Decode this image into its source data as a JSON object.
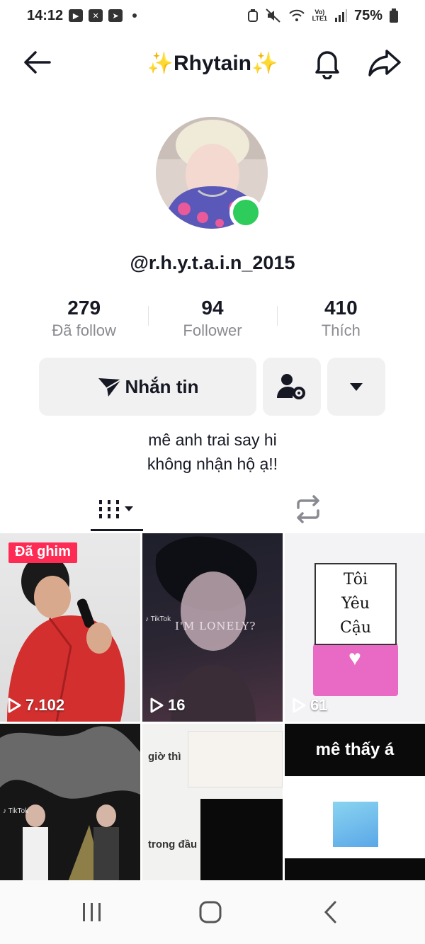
{
  "status": {
    "time": "14:12",
    "network_top": "Vo)",
    "network_bottom": "LTE1",
    "battery": "75%"
  },
  "header": {
    "title": "✨Rhytain✨"
  },
  "profile": {
    "username": "@r.h.y.t.a.i.n_2015",
    "online": true,
    "stats": [
      {
        "value": "279",
        "label": "Đã follow"
      },
      {
        "value": "94",
        "label": "Follower"
      },
      {
        "value": "410",
        "label": "Thích"
      }
    ],
    "message_label": "Nhắn tin",
    "bio_line1": "mê anh trai say hi",
    "bio_line2": "không nhận hộ ạ!!"
  },
  "videos": [
    {
      "views": "7.102",
      "pinned_label": "Đã ghim"
    },
    {
      "views": "16",
      "overlay_text": "I'M LONELY?"
    },
    {
      "views": "61",
      "sign_lines": [
        "Tôi",
        "Yêu",
        "Cậu"
      ]
    },
    {
      "views": ""
    },
    {
      "views": "",
      "caption_top": "giờ thì",
      "caption_bottom": "trong đầu"
    },
    {
      "views": "",
      "overlay_text": "mê thấy á"
    }
  ],
  "colors": {
    "accent": "#fe2c55",
    "online": "#2ecc5a",
    "button_bg": "#f1f1f2",
    "muted_text": "#8a8b91"
  }
}
